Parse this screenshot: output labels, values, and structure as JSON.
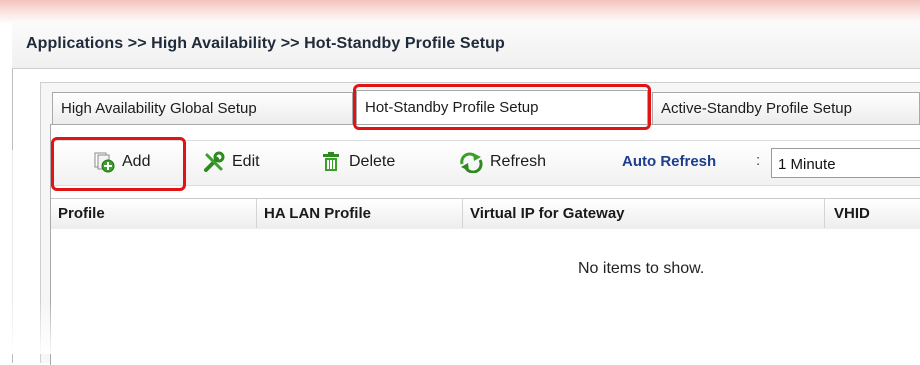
{
  "breadcrumb": "Applications >> High Availability >> Hot-Standby Profile Setup",
  "tabs": [
    {
      "label": "High Availability Global Setup"
    },
    {
      "label": "Hot-Standby Profile Setup",
      "active": true
    },
    {
      "label": "Active-Standby Profile Setup"
    }
  ],
  "toolbar": {
    "add_label": "Add",
    "edit_label": "Edit",
    "delete_label": "Delete",
    "refresh_label": "Refresh",
    "auto_refresh_label": "Auto Refresh",
    "auto_refresh_colon": ":",
    "auto_refresh_value": "1 Minute"
  },
  "grid": {
    "columns": [
      "Profile",
      "HA LAN Profile",
      "Virtual IP for Gateway",
      "VHID"
    ],
    "empty_text": "No items to show."
  },
  "icons": {
    "add": "add-document-icon",
    "edit": "edit-tools-icon",
    "delete": "trash-icon",
    "refresh": "refresh-arrows-icon"
  },
  "colors": {
    "highlight": "#e01414",
    "accent_text": "#1b3e8f",
    "header_rule": "#f0c040"
  }
}
